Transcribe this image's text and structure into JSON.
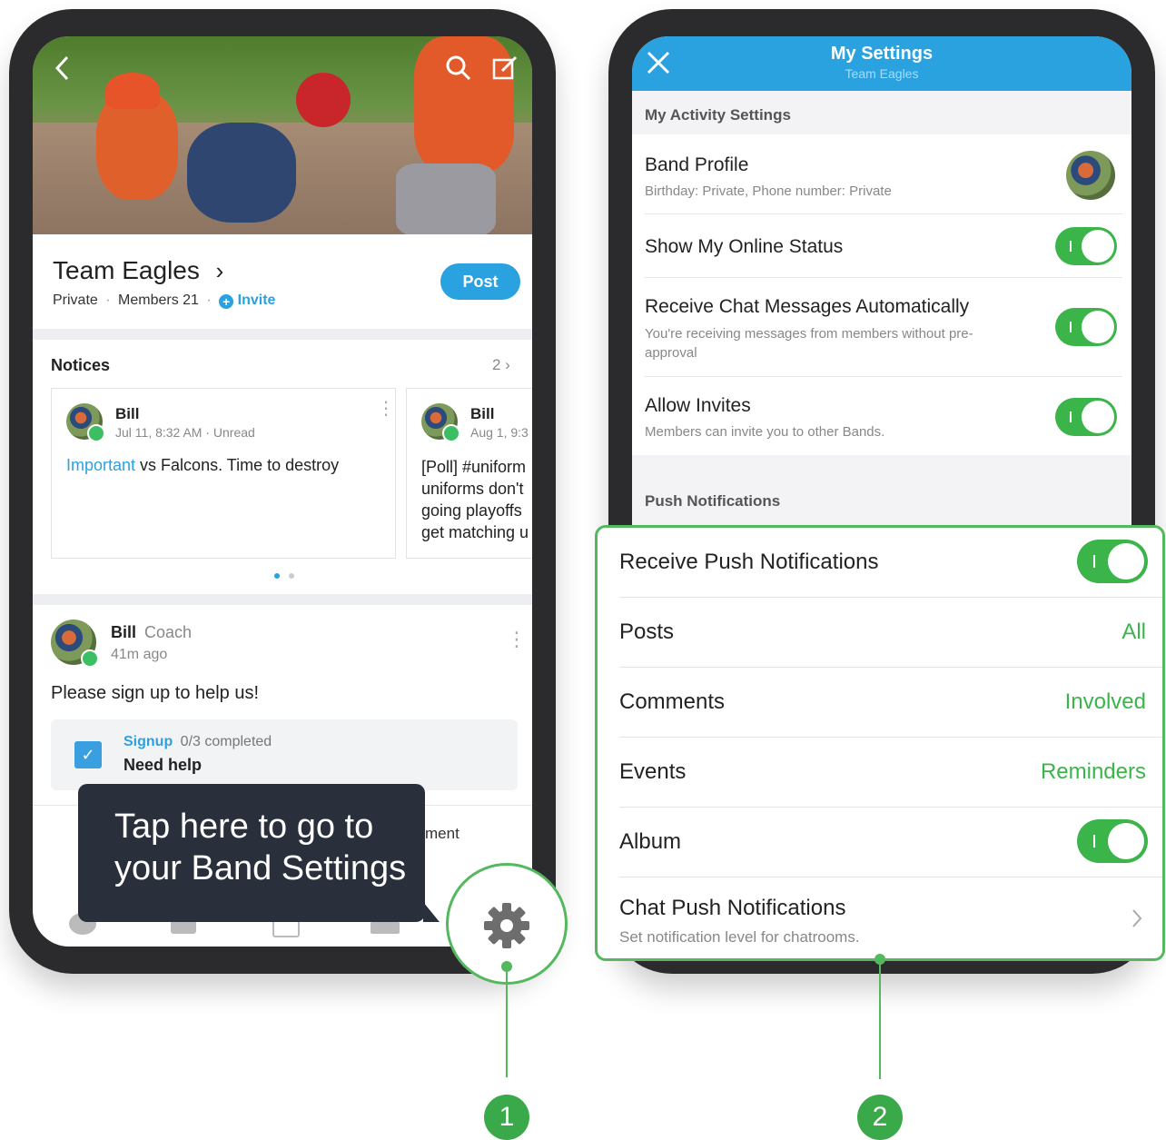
{
  "left_phone": {
    "band": {
      "title": "Team Eagles",
      "chevron": "›",
      "privacy": "Private",
      "members": "Members 21",
      "invite": "Invite",
      "post_button": "Post"
    },
    "notices": {
      "heading": "Notices",
      "count": "2 ›",
      "cards": [
        {
          "author": "Bill",
          "meta": "Jul 11, 8:32 AM · Unread",
          "highlight": "Important",
          "body": " vs Falcons. Time to destroy"
        },
        {
          "author": "Bill",
          "meta": "Aug 1, 9:3",
          "lines": [
            "[Poll] #uniform",
            "uniforms don't",
            "going playoffs",
            "get matching u"
          ]
        }
      ]
    },
    "post": {
      "author": "Bill",
      "role": "Coach",
      "time": "41m ago",
      "text": "Please sign up to help us!",
      "signup_label": "Signup",
      "signup_progress": "0/3 completed",
      "signup_title": "Need help",
      "partial_text": "ment"
    },
    "tooltip": {
      "line1": "Tap here to go to",
      "line2": "your Band Settings"
    },
    "callout_number": "1"
  },
  "right_phone": {
    "header": {
      "title": "My Settings",
      "subtitle": "Team Eagles"
    },
    "activity": {
      "heading": "My Activity Settings",
      "band_profile": {
        "title": "Band Profile",
        "sub": "Birthday: Private, Phone number: Private"
      },
      "online_status": {
        "title": "Show My Online Status",
        "on": true
      },
      "chat_auto": {
        "title": "Receive Chat Messages Automatically",
        "sub1": "You're receiving messages from members without pre-",
        "sub2": "approval",
        "on": true
      },
      "allow_invites": {
        "title": "Allow Invites",
        "sub": "Members can invite you to other Bands.",
        "on": true
      }
    },
    "push": {
      "heading": "Push Notifications",
      "receive": {
        "label": "Receive Push Notifications",
        "on": true
      },
      "posts": {
        "label": "Posts",
        "value": "All"
      },
      "comments": {
        "label": "Comments",
        "value": "Involved"
      },
      "events": {
        "label": "Events",
        "value": "Reminders"
      },
      "album": {
        "label": "Album",
        "on": true
      },
      "chat": {
        "label": "Chat Push Notifications",
        "sub": "Set notification level for chatrooms."
      }
    },
    "callout_number": "2"
  },
  "colors": {
    "accent_blue": "#2aa2e0",
    "toggle_green": "#3bb54a",
    "callout_green": "#54b85f",
    "tooltip_bg": "#2a2f3c"
  }
}
